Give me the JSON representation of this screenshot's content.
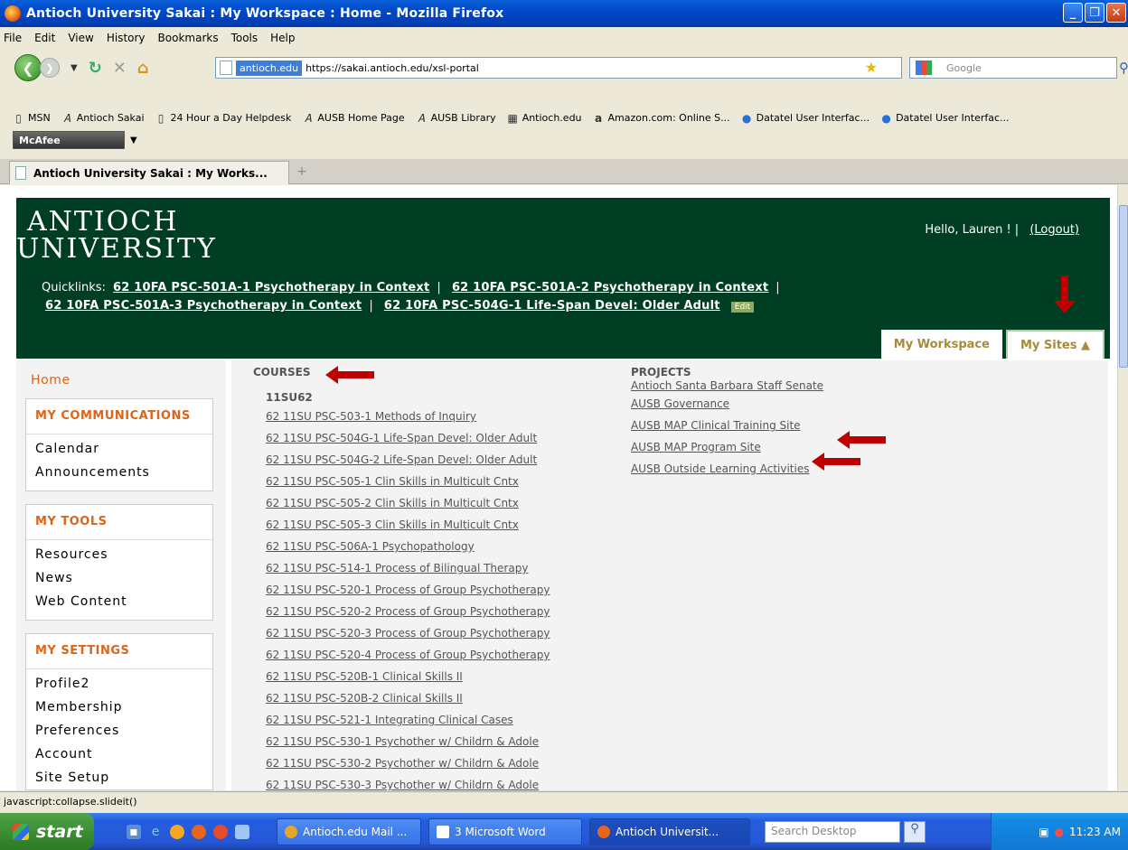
{
  "window": {
    "title": "Antioch University Sakai : My Workspace : Home - Mozilla Firefox"
  },
  "menu": [
    "File",
    "Edit",
    "View",
    "History",
    "Bookmarks",
    "Tools",
    "Help"
  ],
  "nav": {
    "domain": "antioch.edu",
    "url": "https://sakai.antioch.edu/xsl-portal",
    "search_placeholder": "Google"
  },
  "bookmarks": [
    {
      "label": "MSN",
      "icon": "page-icon"
    },
    {
      "label": "Antioch Sakai",
      "icon": "antioch-icon"
    },
    {
      "label": "24 Hour a Day Helpdesk",
      "icon": "page-icon"
    },
    {
      "label": "AUSB Home Page",
      "icon": "antioch-icon"
    },
    {
      "label": "AUSB Library",
      "icon": "antioch-icon"
    },
    {
      "label": "Antioch.edu",
      "icon": "windows-icon"
    },
    {
      "label": "Amazon.com: Online S...",
      "icon": "amazon-icon"
    },
    {
      "label": "Datatel User Interfac...",
      "icon": "datatel-icon"
    },
    {
      "label": "Datatel User Interfac...",
      "icon": "datatel-icon"
    }
  ],
  "mcafee": "McAfee",
  "tab": {
    "label": "Antioch University Sakai : My Works..."
  },
  "header": {
    "logo_line1": "ANTIOCH",
    "logo_line2": "UNIVERSITY",
    "greeting": "Hello, Lauren ! |",
    "logout": "(Logout)",
    "quicklinks_label": "Quicklinks:",
    "quicklinks": [
      "62 10FA PSC-501A-1 Psychotherapy in Context",
      "62 10FA PSC-501A-2 Psychotherapy in Context",
      "62 10FA PSC-501A-3 Psychotherapy in Context",
      "62 10FA PSC-504G-1 Life-Span Devel: Older Adult"
    ],
    "edit": "Edit",
    "tab_workspace": "My Workspace",
    "tab_sites": "My Sites ▲"
  },
  "leftnav": {
    "home": "Home",
    "sections": [
      {
        "title": "MY COMMUNICATIONS",
        "items": [
          "Calendar",
          "Announcements"
        ]
      },
      {
        "title": "MY TOOLS",
        "items": [
          "Resources",
          "News",
          "Web Content"
        ]
      },
      {
        "title": "MY SETTINGS",
        "items": [
          "Profile2",
          "Membership",
          "Preferences",
          "Account",
          "Site Setup"
        ]
      }
    ]
  },
  "courses": {
    "heading": "COURSES",
    "term": "11SU62",
    "links": [
      "62 11SU PSC-503-1 Methods of Inquiry",
      "62 11SU PSC-504G-1 Life-Span Devel: Older Adult",
      "62 11SU PSC-504G-2 Life-Span Devel: Older Adult",
      "62 11SU PSC-505-1 Clin Skills in Multicult Cntx",
      "62 11SU PSC-505-2 Clin Skills in Multicult Cntx",
      "62 11SU PSC-505-3 Clin Skills in Multicult Cntx",
      "62 11SU PSC-506A-1 Psychopathology",
      "62 11SU PSC-514-1 Process of Bilingual Therapy",
      "62 11SU PSC-520-1 Process of Group Psychotherapy",
      "62 11SU PSC-520-2 Process of Group Psychotherapy",
      "62 11SU PSC-520-3 Process of Group Psychotherapy",
      "62 11SU PSC-520-4 Process of Group Psychotherapy",
      "62 11SU PSC-520B-1 Clinical Skills II",
      "62 11SU PSC-520B-2 Clinical Skills II",
      "62 11SU PSC-521-1 Integrating Clinical Cases",
      "62 11SU PSC-530-1 Psychother w/ Childrn & Adole",
      "62 11SU PSC-530-2 Psychother w/ Childrn & Adole",
      "62 11SU PSC-530-3 Psychother w/ Childrn & Adole"
    ]
  },
  "projects": {
    "heading": "PROJECTS",
    "links": [
      "Antioch Santa Barbara Staff Senate",
      "AUSB Governance",
      "AUSB MAP Clinical Training Site",
      "AUSB MAP Program Site",
      "AUSB Outside Learning Activities"
    ]
  },
  "status": "javascript:collapse.slideit()",
  "taskbar": {
    "start": "start",
    "buttons": [
      "Antioch.edu Mail ...",
      "3 Microsoft Word",
      "Antioch Universit..."
    ],
    "search": "Search Desktop",
    "clock": "11:23 AM"
  },
  "colors": {
    "header_bg": "#003e24",
    "accent_orange": "#d9661a",
    "annotation_red": "#c00000"
  }
}
